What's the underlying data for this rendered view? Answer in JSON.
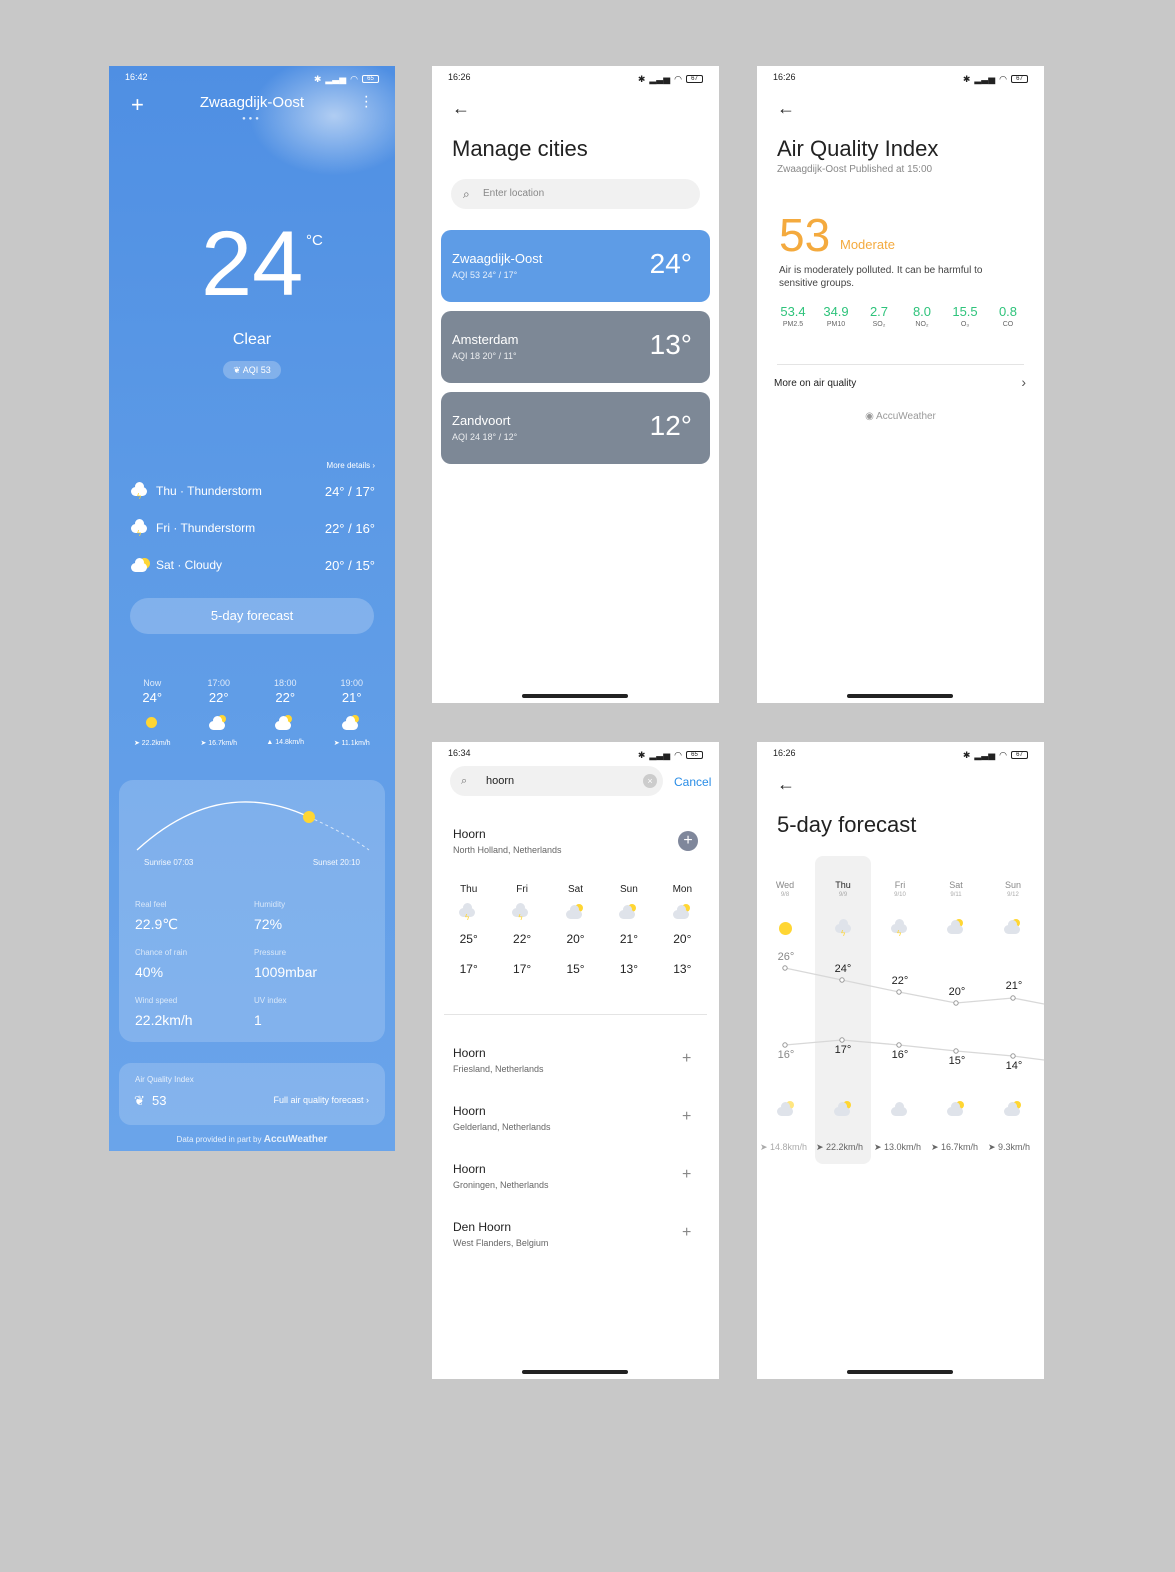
{
  "screen_main": {
    "status_time": "16:42",
    "status_battery": "65",
    "city": "Zwaagdijk-Oost",
    "temp": "24",
    "unit": "°C",
    "condition": "Clear",
    "aqi_badge": "AQI 53",
    "more_details": "More details",
    "days": [
      {
        "label": "Thu · Thunderstorm",
        "range": "24° / 17°",
        "icon": "thunderstorm-icon"
      },
      {
        "label": "Fri · Thunderstorm",
        "range": "22° / 16°",
        "icon": "thunderstorm-icon"
      },
      {
        "label": "Sat · Cloudy",
        "range": "20° / 15°",
        "icon": "cloudy-icon"
      }
    ],
    "five_day_button": "5-day forecast",
    "hours": [
      {
        "time": "Now",
        "temp": "24°",
        "wind": "➤ 22.2km/h",
        "icon": "sun-icon"
      },
      {
        "time": "17:00",
        "temp": "22°",
        "wind": "➤ 16.7km/h",
        "icon": "partly-cloudy-icon"
      },
      {
        "time": "18:00",
        "temp": "22°",
        "wind": "▲ 14.8km/h",
        "icon": "partly-cloudy-icon"
      },
      {
        "time": "19:00",
        "temp": "21°",
        "wind": "➤ 11.1km/h",
        "icon": "partly-cloudy-icon"
      }
    ],
    "sunrise": "Sunrise 07:03",
    "sunset": "Sunset 20:10",
    "stats": [
      {
        "label": "Real feel",
        "value": "22.9℃"
      },
      {
        "label": "Humidity",
        "value": "72%"
      },
      {
        "label": "Chance of rain",
        "value": "40%"
      },
      {
        "label": "Pressure",
        "value": "1009mbar"
      },
      {
        "label": "Wind speed",
        "value": "22.2km/h"
      },
      {
        "label": "UV index",
        "value": "1"
      }
    ],
    "aq_label": "Air Quality Index",
    "aq_value": "53",
    "aq_link": "Full air quality forecast",
    "footer": "Data provided in part by",
    "footer_brand": "AccuWeather"
  },
  "screen_cities": {
    "status_time": "16:26",
    "status_battery": "67",
    "title": "Manage cities",
    "search_placeholder": "Enter location",
    "cities": [
      {
        "name": "Zwaagdijk-Oost",
        "sub": "AQI 53   24° / 17°",
        "temp": "24°",
        "color": "#5e9ce6"
      },
      {
        "name": "Amsterdam",
        "sub": "AQI 18   20° / 11°",
        "temp": "13°",
        "color": "#7d8896"
      },
      {
        "name": "Zandvoort",
        "sub": "AQI 24   18° / 12°",
        "temp": "12°",
        "color": "#7d8896"
      }
    ]
  },
  "screen_aqi": {
    "status_time": "16:26",
    "status_battery": "67",
    "title": "Air Quality Index",
    "subtitle": "Zwaagdijk-Oost Published at 15:00",
    "value": "53",
    "level": "Moderate",
    "description": "Air is moderately polluted. It can be harmful to sensitive groups.",
    "pollutants": [
      {
        "value": "53.4",
        "name": "PM2.5"
      },
      {
        "value": "34.9",
        "name": "PM10"
      },
      {
        "value": "2.7",
        "name": "SO₂"
      },
      {
        "value": "8.0",
        "name": "NO₂"
      },
      {
        "value": "15.5",
        "name": "O₃"
      },
      {
        "value": "0.8",
        "name": "CO"
      }
    ],
    "more": "More on air quality",
    "brand": "AccuWeather"
  },
  "screen_search": {
    "status_time": "16:34",
    "status_battery": "65",
    "query": "hoorn",
    "cancel": "Cancel",
    "first": {
      "name": "Hoorn",
      "sub": "North Holland, Netherlands"
    },
    "days": [
      {
        "day": "Thu",
        "hi": "25°",
        "lo": "17°",
        "icon": "thunderstorm-icon"
      },
      {
        "day": "Fri",
        "hi": "22°",
        "lo": "17°",
        "icon": "thunderstorm-icon"
      },
      {
        "day": "Sat",
        "hi": "20°",
        "lo": "15°",
        "icon": "partly-cloudy-icon"
      },
      {
        "day": "Sun",
        "hi": "21°",
        "lo": "13°",
        "icon": "partly-cloudy-icon"
      },
      {
        "day": "Mon",
        "hi": "20°",
        "lo": "13°",
        "icon": "partly-cloudy-icon"
      }
    ],
    "results": [
      {
        "name": "Hoorn",
        "sub": "Friesland, Netherlands"
      },
      {
        "name": "Hoorn",
        "sub": "Gelderland, Netherlands"
      },
      {
        "name": "Hoorn",
        "sub": "Groningen, Netherlands"
      },
      {
        "name": "Den Hoorn",
        "sub": "West Flanders, Belgium"
      }
    ]
  },
  "screen_forecast": {
    "status_time": "16:26",
    "status_battery": "67",
    "title": "5-day forecast",
    "days": [
      {
        "day": "Wed",
        "date": "9/8",
        "hi": "26°",
        "lo": "16°",
        "wind": "➤ 14.8km/h"
      },
      {
        "day": "Thu",
        "date": "9/9",
        "hi": "24°",
        "lo": "17°",
        "wind": "➤ 22.2km/h"
      },
      {
        "day": "Fri",
        "date": "9/10",
        "hi": "22°",
        "lo": "16°",
        "wind": "➤ 13.0km/h"
      },
      {
        "day": "Sat",
        "date": "9/11",
        "hi": "20°",
        "lo": "15°",
        "wind": "➤ 16.7km/h"
      },
      {
        "day": "Sun",
        "date": "9/12",
        "hi": "21°",
        "lo": "14°",
        "wind": "➤ 9.3km/h"
      }
    ]
  }
}
